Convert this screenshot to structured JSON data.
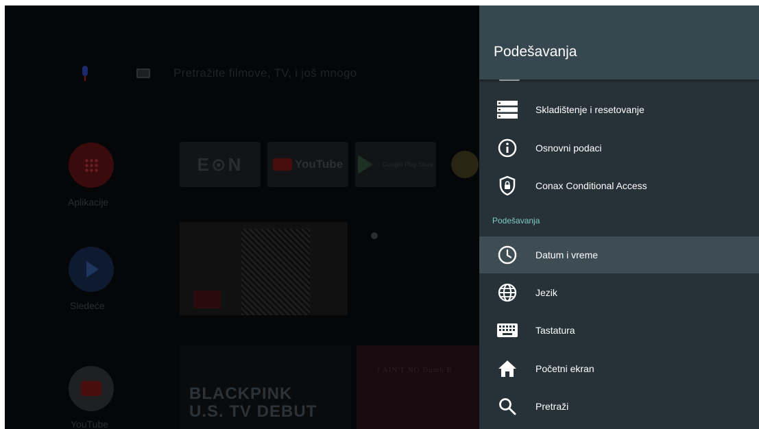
{
  "home": {
    "search_placeholder": "Pretražite filmove, TV, i još mnogo",
    "tiles": {
      "eon": "E⊙N",
      "youtube": "YouTube",
      "google_play": "Google Play Store"
    },
    "side": {
      "apps_label": "Aplikacije",
      "next_label": "Sledeće",
      "youtube_label": "YouTube"
    },
    "banner_title_line1": "BLACKPINK",
    "banner_title_line2": "U.S. TV DEBUT",
    "banner2_text": "I AIN'T NO Dumb B"
  },
  "settings": {
    "title": "Podešavanja",
    "items_top": [
      {
        "label": "Skladištenje i resetovanje",
        "icon": "storage-icon"
      },
      {
        "label": "Osnovni podaci",
        "icon": "info-icon"
      },
      {
        "label": "Conax Conditional Access",
        "icon": "shield-lock-icon"
      }
    ],
    "section_label": "Podešavanja",
    "items_bottom": [
      {
        "label": "Datum i vreme",
        "icon": "clock-icon",
        "selected": true
      },
      {
        "label": "Jezik",
        "icon": "globe-icon"
      },
      {
        "label": "Tastatura",
        "icon": "keyboard-icon"
      },
      {
        "label": "Početni ekran",
        "icon": "home-icon"
      },
      {
        "label": "Pretraži",
        "icon": "search-icon"
      }
    ]
  },
  "colors": {
    "panel_bg": "#263238",
    "header_bg": "#37474f",
    "selected_bg": "#3e4d54",
    "section_accent": "#80cbc4"
  }
}
